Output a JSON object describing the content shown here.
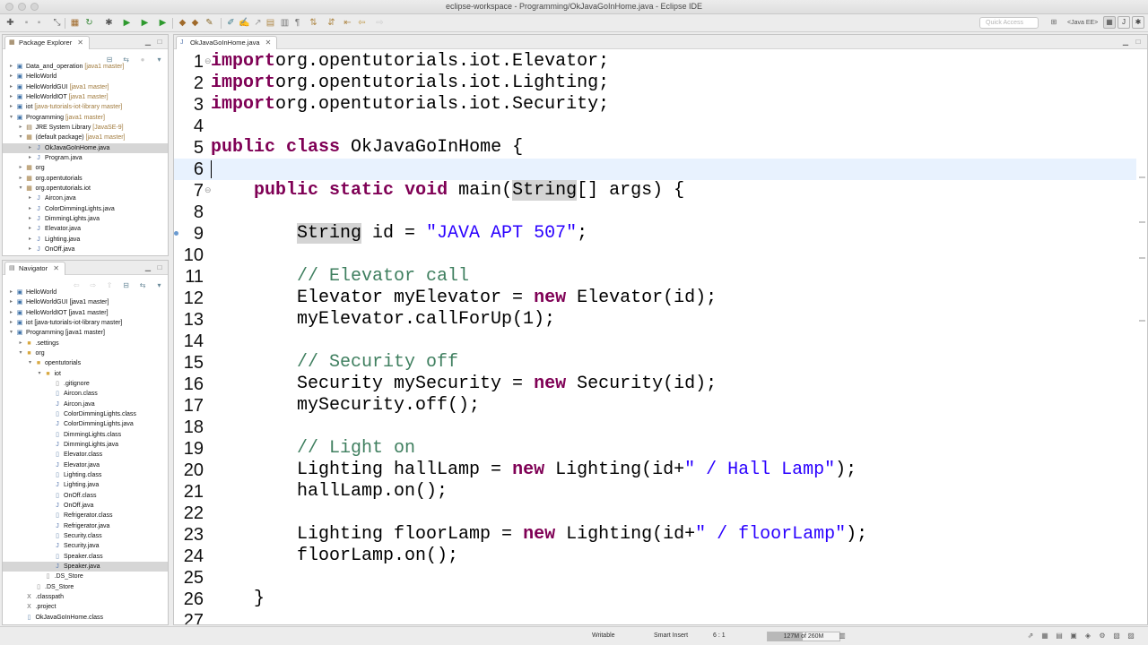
{
  "window": {
    "title": "eclipse-workspace - Programming/OkJavaGoInHome.java - Eclipse IDE"
  },
  "toolbar": {
    "quick_access_placeholder": "Quick Access",
    "perspective_label": "<Java EE>"
  },
  "package_explorer": {
    "tab_label": "Package Explorer",
    "items": [
      {
        "label": "Data_and_operation",
        "decor": " [java1 master]",
        "depth": 0,
        "arrow": "▸",
        "icon": "project-icon",
        "glyph": "▣",
        "color": "#3a6ea5"
      },
      {
        "label": "HelloWorld",
        "decor": "",
        "depth": 0,
        "arrow": "▸",
        "icon": "project-icon",
        "glyph": "▣",
        "color": "#3a6ea5"
      },
      {
        "label": "HelloWorldGUI",
        "decor": " [java1 master]",
        "depth": 0,
        "arrow": "▸",
        "icon": "project-icon",
        "glyph": "▣",
        "color": "#3a6ea5"
      },
      {
        "label": "HelloWorldIOT",
        "decor": " [java1 master]",
        "depth": 0,
        "arrow": "▸",
        "icon": "project-icon",
        "glyph": "▣",
        "color": "#3a6ea5"
      },
      {
        "label": "iot",
        "decor": " [java-tutorials-iot-library master]",
        "depth": 0,
        "arrow": "▸",
        "icon": "project-icon",
        "glyph": "▣",
        "color": "#3a6ea5"
      },
      {
        "label": "Programming",
        "decor": " [java1 master]",
        "depth": 0,
        "arrow": "▾",
        "icon": "project-icon",
        "glyph": "▣",
        "color": "#3a6ea5"
      },
      {
        "label": "JRE System Library",
        "decor": " [JavaSE-9]",
        "depth": 1,
        "arrow": "▸",
        "icon": "library-icon",
        "glyph": "▤",
        "color": "#8a6a3a"
      },
      {
        "label": "(default package)",
        "decor": " [java1 master]",
        "depth": 1,
        "arrow": "▾",
        "icon": "package-icon",
        "glyph": "▦",
        "color": "#a07a3c"
      },
      {
        "label": "OkJavaGoInHome.java",
        "decor": "",
        "depth": 2,
        "arrow": "▸",
        "icon": "java-file-icon",
        "glyph": "J",
        "color": "#5a7ab0",
        "selected": true
      },
      {
        "label": "Program.java",
        "decor": "",
        "depth": 2,
        "arrow": "▸",
        "icon": "java-file-icon",
        "glyph": "J",
        "color": "#5a7ab0"
      },
      {
        "label": "org",
        "decor": "",
        "depth": 1,
        "arrow": "▸",
        "icon": "package-icon",
        "glyph": "▦",
        "color": "#a07a3c"
      },
      {
        "label": "org.opentutorials",
        "decor": "",
        "depth": 1,
        "arrow": "▸",
        "icon": "package-icon",
        "glyph": "▦",
        "color": "#a07a3c"
      },
      {
        "label": "org.opentutorials.iot",
        "decor": "",
        "depth": 1,
        "arrow": "▾",
        "icon": "package-icon",
        "glyph": "▦",
        "color": "#a07a3c"
      },
      {
        "label": "Aircon.java",
        "decor": "",
        "depth": 2,
        "arrow": "▸",
        "icon": "java-file-icon",
        "glyph": "J",
        "color": "#5a7ab0"
      },
      {
        "label": "ColorDimmingLights.java",
        "decor": "",
        "depth": 2,
        "arrow": "▸",
        "icon": "java-file-icon",
        "glyph": "J",
        "color": "#5a7ab0"
      },
      {
        "label": "DimmingLights.java",
        "decor": "",
        "depth": 2,
        "arrow": "▸",
        "icon": "java-file-icon",
        "glyph": "J",
        "color": "#5a7ab0"
      },
      {
        "label": "Elevator.java",
        "decor": "",
        "depth": 2,
        "arrow": "▸",
        "icon": "java-file-icon",
        "glyph": "J",
        "color": "#5a7ab0"
      },
      {
        "label": "Lighting.java",
        "decor": "",
        "depth": 2,
        "arrow": "▸",
        "icon": "java-file-icon",
        "glyph": "J",
        "color": "#5a7ab0"
      },
      {
        "label": "OnOff.java",
        "decor": "",
        "depth": 2,
        "arrow": "▸",
        "icon": "java-file-icon",
        "glyph": "J",
        "color": "#5a7ab0"
      }
    ]
  },
  "navigator": {
    "tab_label": "Navigator",
    "items": [
      {
        "label": "HelloWorld",
        "decor": "",
        "depth": 0,
        "arrow": "▸",
        "icon": "project-icon",
        "glyph": "▣",
        "color": "#3a6ea5"
      },
      {
        "label": "HelloWorldGUI [java1 master]",
        "decor": "",
        "depth": 0,
        "arrow": "▸",
        "icon": "project-icon",
        "glyph": "▣",
        "color": "#3a6ea5"
      },
      {
        "label": "HelloWorldIOT [java1 master]",
        "decor": "",
        "depth": 0,
        "arrow": "▸",
        "icon": "project-icon",
        "glyph": "▣",
        "color": "#3a6ea5"
      },
      {
        "label": "iot [java-tutorials-iot-library master]",
        "decor": "",
        "depth": 0,
        "arrow": "▸",
        "icon": "project-icon",
        "glyph": "▣",
        "color": "#3a6ea5"
      },
      {
        "label": "Programming [java1 master]",
        "decor": "",
        "depth": 0,
        "arrow": "▾",
        "icon": "project-icon",
        "glyph": "▣",
        "color": "#3a6ea5"
      },
      {
        "label": ".settings",
        "decor": "",
        "depth": 1,
        "arrow": "▸",
        "icon": "folder-icon",
        "glyph": "■",
        "color": "#d8a840"
      },
      {
        "label": "org",
        "decor": "",
        "depth": 1,
        "arrow": "▾",
        "icon": "folder-icon",
        "glyph": "■",
        "color": "#d8a840"
      },
      {
        "label": "opentutorials",
        "decor": "",
        "depth": 2,
        "arrow": "▾",
        "icon": "folder-icon",
        "glyph": "■",
        "color": "#d8a840"
      },
      {
        "label": "iot",
        "decor": "",
        "depth": 3,
        "arrow": "▾",
        "icon": "folder-icon",
        "glyph": "■",
        "color": "#d8a840"
      },
      {
        "label": ".gitignore",
        "decor": "",
        "depth": 4,
        "arrow": "",
        "icon": "file-icon",
        "glyph": "▯",
        "color": "#888888"
      },
      {
        "label": "Aircon.class",
        "decor": "",
        "depth": 4,
        "arrow": "",
        "icon": "class-file-icon",
        "glyph": "▯",
        "color": "#6a8ab0"
      },
      {
        "label": "Aircon.java",
        "decor": "",
        "depth": 4,
        "arrow": "",
        "icon": "java-file-icon",
        "glyph": "J",
        "color": "#5a7ab0"
      },
      {
        "label": "ColorDimmingLights.class",
        "decor": "",
        "depth": 4,
        "arrow": "",
        "icon": "class-file-icon",
        "glyph": "▯",
        "color": "#6a8ab0"
      },
      {
        "label": "ColorDimmingLights.java",
        "decor": "",
        "depth": 4,
        "arrow": "",
        "icon": "java-file-icon",
        "glyph": "J",
        "color": "#5a7ab0"
      },
      {
        "label": "DimmingLights.class",
        "decor": "",
        "depth": 4,
        "arrow": "",
        "icon": "class-file-icon",
        "glyph": "▯",
        "color": "#6a8ab0"
      },
      {
        "label": "DimmingLights.java",
        "decor": "",
        "depth": 4,
        "arrow": "",
        "icon": "java-file-icon",
        "glyph": "J",
        "color": "#5a7ab0"
      },
      {
        "label": "Elevator.class",
        "decor": "",
        "depth": 4,
        "arrow": "",
        "icon": "class-file-icon",
        "glyph": "▯",
        "color": "#6a8ab0"
      },
      {
        "label": "Elevator.java",
        "decor": "",
        "depth": 4,
        "arrow": "",
        "icon": "java-file-icon",
        "glyph": "J",
        "color": "#5a7ab0"
      },
      {
        "label": "Lighting.class",
        "decor": "",
        "depth": 4,
        "arrow": "",
        "icon": "class-file-icon",
        "glyph": "▯",
        "color": "#6a8ab0"
      },
      {
        "label": "Lighting.java",
        "decor": "",
        "depth": 4,
        "arrow": "",
        "icon": "java-file-icon",
        "glyph": "J",
        "color": "#5a7ab0"
      },
      {
        "label": "OnOff.class",
        "decor": "",
        "depth": 4,
        "arrow": "",
        "icon": "class-file-icon",
        "glyph": "▯",
        "color": "#6a8ab0"
      },
      {
        "label": "OnOff.java",
        "decor": "",
        "depth": 4,
        "arrow": "",
        "icon": "java-file-icon",
        "glyph": "J",
        "color": "#5a7ab0"
      },
      {
        "label": "Refrigerator.class",
        "decor": "",
        "depth": 4,
        "arrow": "",
        "icon": "class-file-icon",
        "glyph": "▯",
        "color": "#6a8ab0"
      },
      {
        "label": "Refrigerator.java",
        "decor": "",
        "depth": 4,
        "arrow": "",
        "icon": "java-file-icon",
        "glyph": "J",
        "color": "#5a7ab0"
      },
      {
        "label": "Security.class",
        "decor": "",
        "depth": 4,
        "arrow": "",
        "icon": "class-file-icon",
        "glyph": "▯",
        "color": "#6a8ab0"
      },
      {
        "label": "Security.java",
        "decor": "",
        "depth": 4,
        "arrow": "",
        "icon": "java-file-icon",
        "glyph": "J",
        "color": "#5a7ab0"
      },
      {
        "label": "Speaker.class",
        "decor": "",
        "depth": 4,
        "arrow": "",
        "icon": "class-file-icon",
        "glyph": "▯",
        "color": "#6a8ab0"
      },
      {
        "label": "Speaker.java",
        "decor": "",
        "depth": 4,
        "arrow": "",
        "icon": "java-file-icon",
        "glyph": "J",
        "color": "#5a7ab0",
        "selected": true
      },
      {
        "label": ".DS_Store",
        "decor": "",
        "depth": 3,
        "arrow": "",
        "icon": "file-icon",
        "glyph": "▯",
        "color": "#888888"
      },
      {
        "label": ".DS_Store",
        "decor": "",
        "depth": 2,
        "arrow": "",
        "icon": "file-icon",
        "glyph": "▯",
        "color": "#888888"
      },
      {
        "label": ".classpath",
        "decor": "",
        "depth": 1,
        "arrow": "",
        "icon": "xml-file-icon",
        "glyph": "X",
        "color": "#666666"
      },
      {
        "label": ".project",
        "decor": "",
        "depth": 1,
        "arrow": "",
        "icon": "xml-file-icon",
        "glyph": "X",
        "color": "#666666"
      },
      {
        "label": "OkJavaGoInHome.class",
        "decor": "",
        "depth": 1,
        "arrow": "",
        "icon": "class-file-icon",
        "glyph": "▯",
        "color": "#6a8ab0"
      }
    ]
  },
  "editor": {
    "tab_label": "OkJavaGoInHome.java",
    "current_line": 6,
    "lines": [
      {
        "n": "1",
        "fold": "⊖",
        "tokens": [
          [
            "kw",
            "import"
          ],
          [
            "",
            "org.opentutorials.iot.Elevator;"
          ]
        ]
      },
      {
        "n": "2",
        "tokens": [
          [
            "kw",
            "import"
          ],
          [
            "",
            "org.opentutorials.iot.Lighting;"
          ]
        ]
      },
      {
        "n": "3",
        "tokens": [
          [
            "kw",
            "import"
          ],
          [
            "",
            "org.opentutorials.iot.Security;"
          ]
        ]
      },
      {
        "n": "4",
        "tokens": []
      },
      {
        "n": "5",
        "tokens": [
          [
            "kw",
            "public"
          ],
          [
            "",
            " "
          ],
          [
            "kw",
            "class"
          ],
          [
            "",
            " OkJavaGoInHome {"
          ]
        ]
      },
      {
        "n": "6",
        "tokens": []
      },
      {
        "n": "7",
        "fold": "⊖",
        "tokens": [
          [
            "",
            "    "
          ],
          [
            "kw",
            "public"
          ],
          [
            "",
            " "
          ],
          [
            "kw",
            "static"
          ],
          [
            "",
            " "
          ],
          [
            "kw",
            "void"
          ],
          [
            "",
            " main("
          ],
          [
            "occ",
            "String"
          ],
          [
            "",
            "[] args) {"
          ]
        ]
      },
      {
        "n": "8",
        "tokens": []
      },
      {
        "n": "9",
        "tokens": [
          [
            "",
            "        "
          ],
          [
            "occ",
            "String"
          ],
          [
            "",
            " id = "
          ],
          [
            "str",
            "\"JAVA APT 507\""
          ],
          [
            "",
            ";"
          ]
        ]
      },
      {
        "n": "10",
        "tokens": []
      },
      {
        "n": "11",
        "tokens": [
          [
            "",
            "        "
          ],
          [
            "cmt",
            "// Elevator call"
          ]
        ]
      },
      {
        "n": "12",
        "tokens": [
          [
            "",
            "        Elevator myElevator = "
          ],
          [
            "kw",
            "new"
          ],
          [
            "",
            " Elevator(id);"
          ]
        ]
      },
      {
        "n": "13",
        "tokens": [
          [
            "",
            "        myElevator.callForUp(1);"
          ]
        ]
      },
      {
        "n": "14",
        "tokens": []
      },
      {
        "n": "15",
        "tokens": [
          [
            "",
            "        "
          ],
          [
            "cmt",
            "// Security off"
          ]
        ]
      },
      {
        "n": "16",
        "tokens": [
          [
            "",
            "        Security mySecurity = "
          ],
          [
            "kw",
            "new"
          ],
          [
            "",
            " Security(id);"
          ]
        ]
      },
      {
        "n": "17",
        "tokens": [
          [
            "",
            "        mySecurity.off();"
          ]
        ]
      },
      {
        "n": "18",
        "tokens": []
      },
      {
        "n": "19",
        "tokens": [
          [
            "",
            "        "
          ],
          [
            "cmt",
            "// Light on"
          ]
        ]
      },
      {
        "n": "20",
        "tokens": [
          [
            "",
            "        Lighting hallLamp = "
          ],
          [
            "kw",
            "new"
          ],
          [
            "",
            " Lighting(id+"
          ],
          [
            "str",
            "\" / Hall Lamp\""
          ],
          [
            "",
            ");"
          ]
        ]
      },
      {
        "n": "21",
        "tokens": [
          [
            "",
            "        hallLamp.on();"
          ]
        ]
      },
      {
        "n": "22",
        "tokens": []
      },
      {
        "n": "23",
        "tokens": [
          [
            "",
            "        Lighting floorLamp = "
          ],
          [
            "kw",
            "new"
          ],
          [
            "",
            " Lighting(id+"
          ],
          [
            "str",
            "\" / floorLamp\""
          ],
          [
            "",
            ");"
          ]
        ]
      },
      {
        "n": "24",
        "tokens": [
          [
            "",
            "        floorLamp.on();"
          ]
        ]
      },
      {
        "n": "25",
        "tokens": []
      },
      {
        "n": "26",
        "tokens": [
          [
            "",
            "    }"
          ]
        ]
      },
      {
        "n": "27",
        "tokens": []
      }
    ]
  },
  "status": {
    "writable": "Writable",
    "insert_mode": "Smart Insert",
    "position": "6 : 1",
    "heap": "127M of 260M",
    "heap_fraction": 0.49
  },
  "colors": {
    "keyword": "#7f0055",
    "string": "#2a00ff",
    "comment": "#3f7f5f",
    "current_line": "#e8f2fe",
    "selection": "#d6d6d6"
  }
}
